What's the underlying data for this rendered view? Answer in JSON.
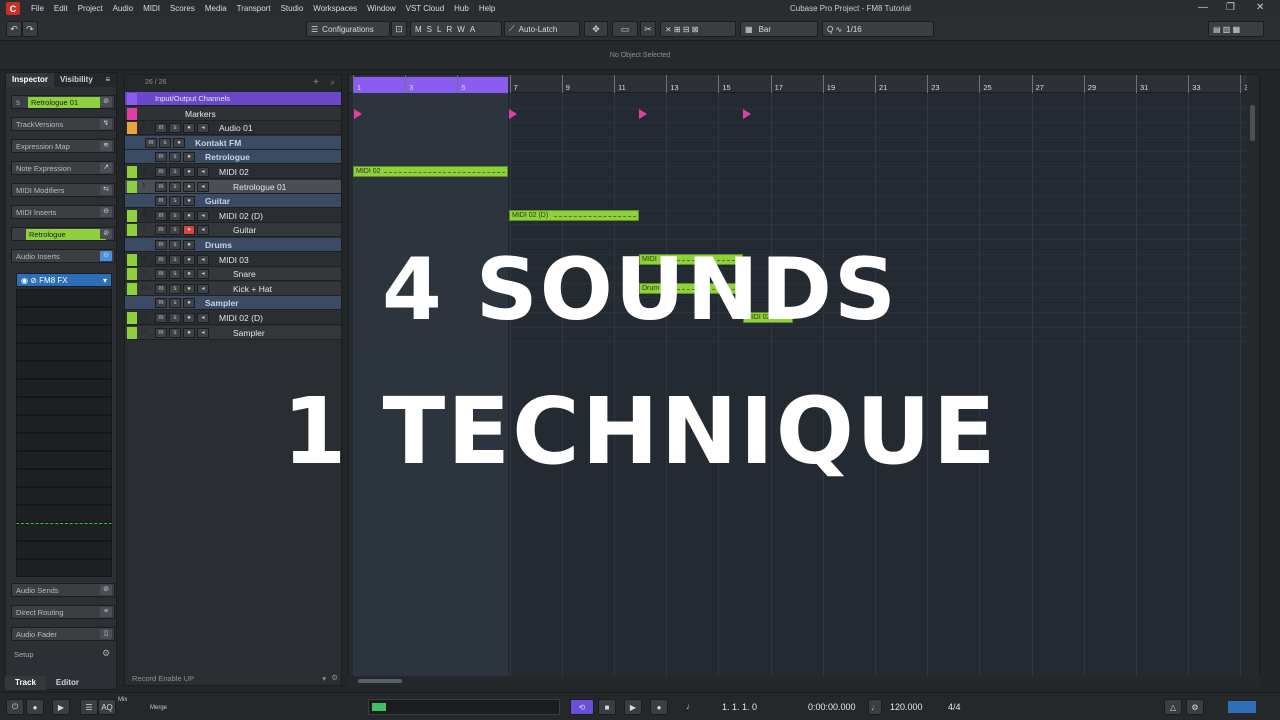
{
  "menu": [
    "File",
    "Edit",
    "Project",
    "Audio",
    "MIDI",
    "Scores",
    "Media",
    "Transport",
    "Studio",
    "Workspaces",
    "Window",
    "VST Cloud",
    "Hub",
    "Help"
  ],
  "window_title": "Cubase Pro Project - FM8 Tutorial",
  "toolbar": {
    "configurations": "Configurations",
    "mode_letters": [
      "M",
      "S",
      "L",
      "R",
      "W",
      "A"
    ],
    "automation": "Auto-Latch",
    "grid_type": "Bar",
    "quantize": "1/16"
  },
  "infoline": "No Object Selected",
  "inspector": {
    "tab_inspector": "Inspector",
    "tab_visibility": "Visibility",
    "track_name": "Retrologue 01",
    "rows": [
      "TrackVersions",
      "Expression Map",
      "Note Expression",
      "MIDI Modifiers",
      "MIDI Inserts"
    ],
    "instrument": "Retrologue",
    "audio_inserts": "Audio Inserts",
    "insert_plugin": "FM8 FX",
    "bottom_rows": [
      "Audio Sends",
      "Direct Routing",
      "Audio Fader"
    ],
    "setup": "Setup",
    "footer_tabs": [
      "Track",
      "Editor"
    ]
  },
  "tracklist": {
    "header_count": "26 / 26",
    "footer": "Record Enable UP",
    "tracks": [
      {
        "num": "",
        "name": "Input/Output Channels",
        "kind": "io"
      },
      {
        "num": "",
        "name": "Markers",
        "kind": "marker"
      },
      {
        "num": "1",
        "name": "Audio 01",
        "kind": "audio"
      },
      {
        "num": "",
        "name": "Kontakt FM",
        "kind": "folder"
      },
      {
        "num": "",
        "name": "Retrologue",
        "kind": "folder"
      },
      {
        "num": "4",
        "name": "MIDI 02",
        "kind": "midi"
      },
      {
        "num": "5",
        "name": "Retrologue 01",
        "kind": "instr"
      },
      {
        "num": "",
        "name": "Guitar",
        "kind": "folder"
      },
      {
        "num": "6",
        "name": "MIDI 02 (D)",
        "kind": "midi"
      },
      {
        "num": "7",
        "name": "Guitar",
        "kind": "instr"
      },
      {
        "num": "",
        "name": "Drums",
        "kind": "folder"
      },
      {
        "num": "8",
        "name": "MIDI 03",
        "kind": "midi"
      },
      {
        "num": "9",
        "name": "Snare",
        "kind": "instr"
      },
      {
        "num": "10",
        "name": "Kick + Hat",
        "kind": "instr"
      },
      {
        "num": "",
        "name": "Sampler",
        "kind": "folder"
      },
      {
        "num": "11",
        "name": "MIDI 02 (D)",
        "kind": "midi"
      },
      {
        "num": "12",
        "name": "Sampler",
        "kind": "instr"
      }
    ]
  },
  "ruler": [
    "1",
    "3",
    "5",
    "7",
    "9",
    "11",
    "13",
    "15",
    "17",
    "19",
    "21",
    "23",
    "25",
    "27",
    "29",
    "31",
    "33",
    "35"
  ],
  "parts": [
    {
      "label": "MIDI 02"
    },
    {
      "label": "MIDI 02 (D)"
    },
    {
      "label": "MIDI"
    },
    {
      "label": "Drum"
    },
    {
      "label": "MIDI 02"
    }
  ],
  "overlay": {
    "line1": "4 SOUNDS",
    "line2": "1 TECHNIQUE"
  },
  "transport": {
    "mix": "Mix",
    "merge": "Merge",
    "position": "1. 1. 1.   0",
    "time": "0:00:00.000",
    "tempo": "120.000",
    "signature": "4/4"
  },
  "colors": {
    "cycle": "#8a5cf2",
    "marker": "#e23ea5",
    "part": "#8fd13c",
    "folder": "#3b4b63"
  }
}
